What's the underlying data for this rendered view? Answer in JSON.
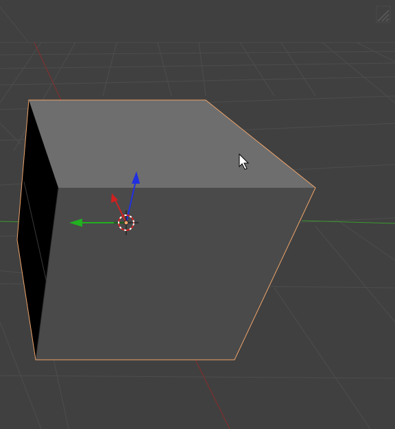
{
  "viewport": {
    "background": "#404040",
    "grid_color": "#4d4d4d",
    "x_axis_color": "#8a2c2c",
    "y_axis_color": "#3b9a2e",
    "selection_outline_color": "#f0a56b"
  },
  "object": {
    "type": "cube",
    "selected": true,
    "top_face_color": "#6e6e6e",
    "front_face_color": "#4a4a4a",
    "side_face_color": "#000000"
  },
  "gizmo": {
    "x_arrow_color": "#d02020",
    "y_arrow_color": "#20b020",
    "z_arrow_color": "#2030e0"
  },
  "icons": {
    "cursor": "mouse-pointer-icon",
    "pivot": "3d-cursor-icon",
    "corner": "area-split-corner-icon"
  }
}
